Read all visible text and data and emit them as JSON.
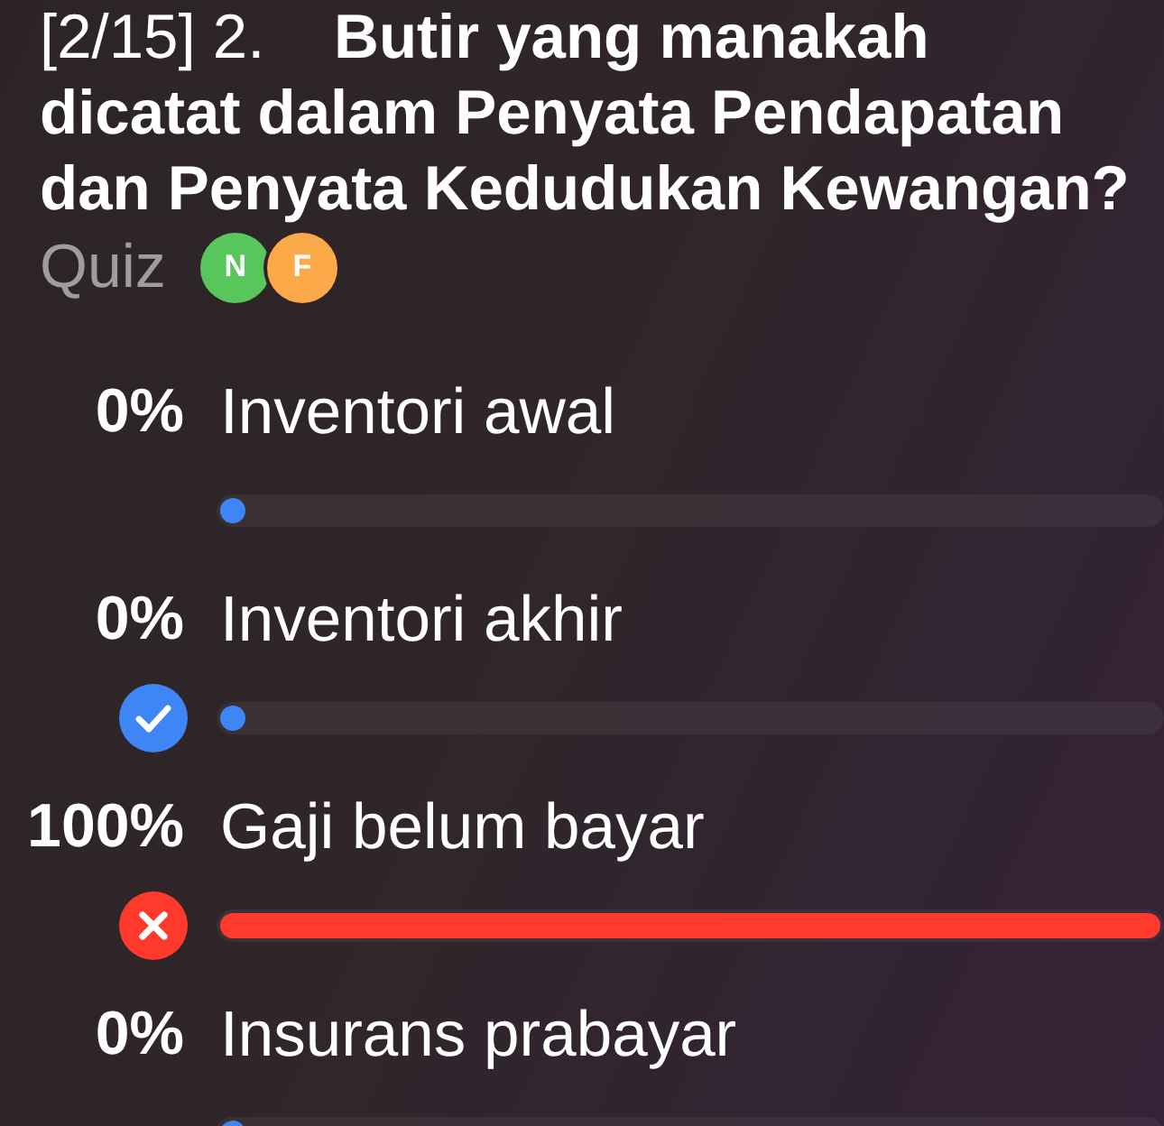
{
  "question": "[2/15] 2.    **Butir yang manakah dicatat dalam Penyata Pendapatan dan Penyata Kedudukan Kewangan?**",
  "type_label": "Quiz",
  "avatars": [
    {
      "initial": "N",
      "color": "#58c65a"
    },
    {
      "initial": "F",
      "color": "#fca94a"
    }
  ],
  "options": [
    {
      "percent": "0%",
      "label": "Inventori awal",
      "level": 0,
      "correct": false,
      "selected": false
    },
    {
      "percent": "0%",
      "label": "Inventori akhir",
      "level": 0,
      "correct": true,
      "selected": false
    },
    {
      "percent": "100%",
      "label": "Gaji belum bayar",
      "level": 1,
      "correct": false,
      "selected": true
    },
    {
      "percent": "0%",
      "label": "Insurans prabayar",
      "level": 0,
      "correct": false,
      "selected": false
    }
  ]
}
